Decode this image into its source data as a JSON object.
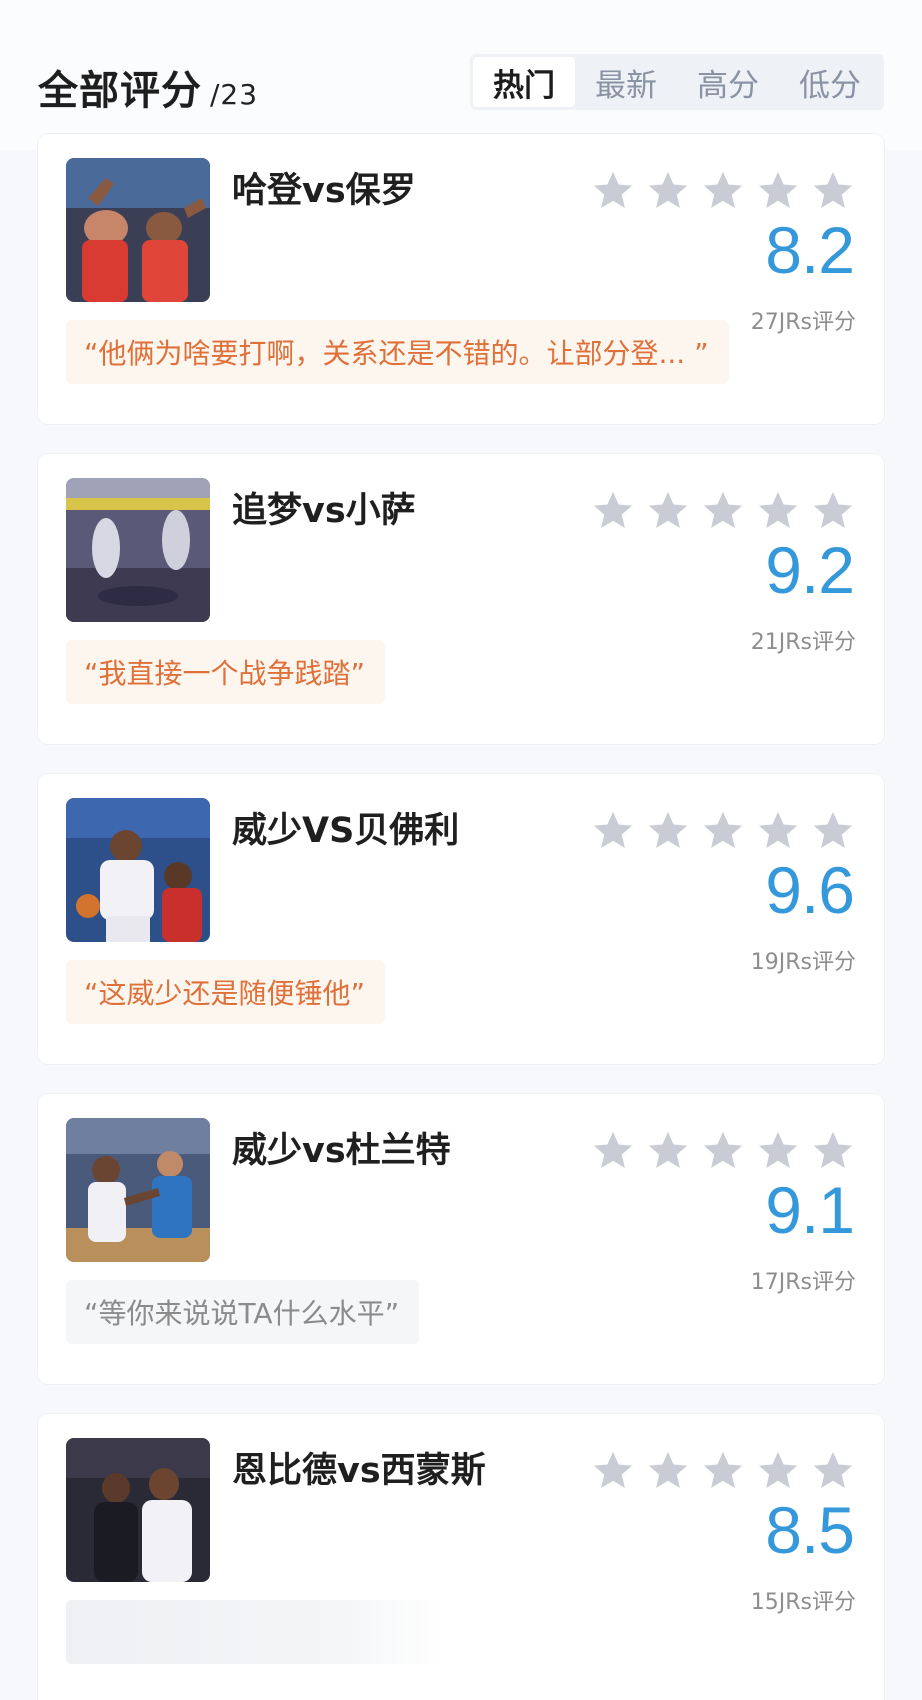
{
  "header": {
    "title": "全部评分",
    "count": "/23",
    "tabs": [
      {
        "label": "热门",
        "active": true
      },
      {
        "label": "最新",
        "active": false
      },
      {
        "label": "高分",
        "active": false
      },
      {
        "label": "低分",
        "active": false
      }
    ]
  },
  "colors": {
    "score_blue": "#3498db",
    "quote_orange": "#e0703a",
    "quote_gray": "#8b8b8b",
    "star_gray": "#c9ccd4"
  },
  "cards": [
    {
      "matchup": "哈登vs保罗",
      "score": "8.2",
      "votes": "27JRs评分",
      "quote": "“他俩为啥要打啊，关系还是不错的。让部分登... ”",
      "quote_style": "orange",
      "thumb_icon": "basketball-photo-icon"
    },
    {
      "matchup": "追梦vs小萨",
      "score": "9.2",
      "votes": "21JRs评分",
      "quote": "“我直接一个战争践踏”",
      "quote_style": "orange",
      "thumb_icon": "basketball-photo-icon"
    },
    {
      "matchup": "威少VS贝佛利",
      "score": "9.6",
      "votes": "19JRs评分",
      "quote": "“这威少还是随便锤他”",
      "quote_style": "orange",
      "thumb_icon": "basketball-photo-icon"
    },
    {
      "matchup": "威少vs杜兰特",
      "score": "9.1",
      "votes": "17JRs评分",
      "quote": "“等你来说说TA什么水平”",
      "quote_style": "gray",
      "thumb_icon": "basketball-photo-icon"
    },
    {
      "matchup": "恩比德vs西蒙斯",
      "score": "8.5",
      "votes": "15JRs评分",
      "quote": "",
      "quote_style": "faded",
      "thumb_icon": "basketball-photo-icon"
    }
  ]
}
